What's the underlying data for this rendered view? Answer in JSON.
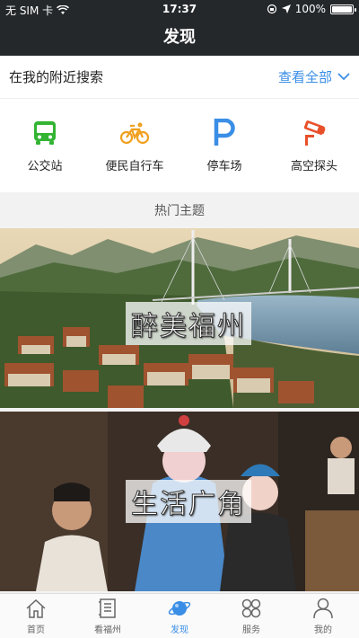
{
  "status": {
    "carrier": "无 SIM 卡",
    "time": "17:37",
    "battery": "100%",
    "battery_level": 1.0
  },
  "nav": {
    "title": "发现"
  },
  "nearby": {
    "title": "在我的附近搜索",
    "view_all": "查看全部",
    "items": [
      {
        "label": "公交站",
        "icon": "bus-icon",
        "color": "#33b433"
      },
      {
        "label": "便民自行车",
        "icon": "bicycle-icon",
        "color": "#f0a020"
      },
      {
        "label": "停车场",
        "icon": "parking-icon",
        "color": "#3a8ee6"
      },
      {
        "label": "高空探头",
        "icon": "camera-icon",
        "color": "#e8502a"
      }
    ]
  },
  "section": {
    "title": "热门主题"
  },
  "banners": [
    {
      "label": "醉美福州"
    },
    {
      "label": "生活广角"
    }
  ],
  "tabs": [
    {
      "label": "首页",
      "icon": "home-icon",
      "active": false
    },
    {
      "label": "看福州",
      "icon": "document-icon",
      "active": false
    },
    {
      "label": "发现",
      "icon": "planet-icon",
      "active": true
    },
    {
      "label": "服务",
      "icon": "grid-icon",
      "active": false
    },
    {
      "label": "我的",
      "icon": "user-icon",
      "active": false
    }
  ],
  "colors": {
    "accent": "#3a8ee6",
    "nav_bg": "#25282b"
  }
}
